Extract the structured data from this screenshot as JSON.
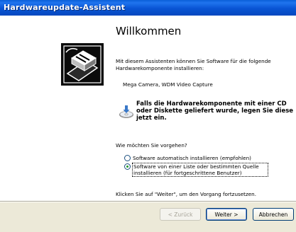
{
  "window": {
    "title": "Hardwareupdate-Assistent"
  },
  "main": {
    "heading": "Willkommen",
    "intro": "Mit diesem Assistenten können Sie Software für die folgende Hardwarekomponente installieren:",
    "device": "Mega Camera, WDM Video Capture",
    "cd_notice": "Falls die Hardwarekomponente mit einer CD oder Diskette geliefert wurde, legen Sie diese jetzt ein.",
    "question": "Wie möchten Sie vorgehen?",
    "options": [
      {
        "label": "Software automatisch installieren (empfohlen)",
        "selected": false
      },
      {
        "label": "Software von einer Liste oder bestimmten Quelle installieren (für fortgeschrittene Benutzer)",
        "selected": true
      }
    ],
    "footer_text": "Klicken Sie auf \"Weiter\", um den Vorgang fortzusetzen."
  },
  "buttons": {
    "back": "< Zurück",
    "next": "Weiter >",
    "cancel": "Abbrechen"
  },
  "icons": {
    "wizard_graphic": "hardware-wizard-icon",
    "cd": "cd-disc-icon"
  },
  "colors": {
    "titlebar": "#0a5fd8",
    "dialog_bg": "#ece9d8",
    "radio_selected": "#1e9b2a"
  }
}
